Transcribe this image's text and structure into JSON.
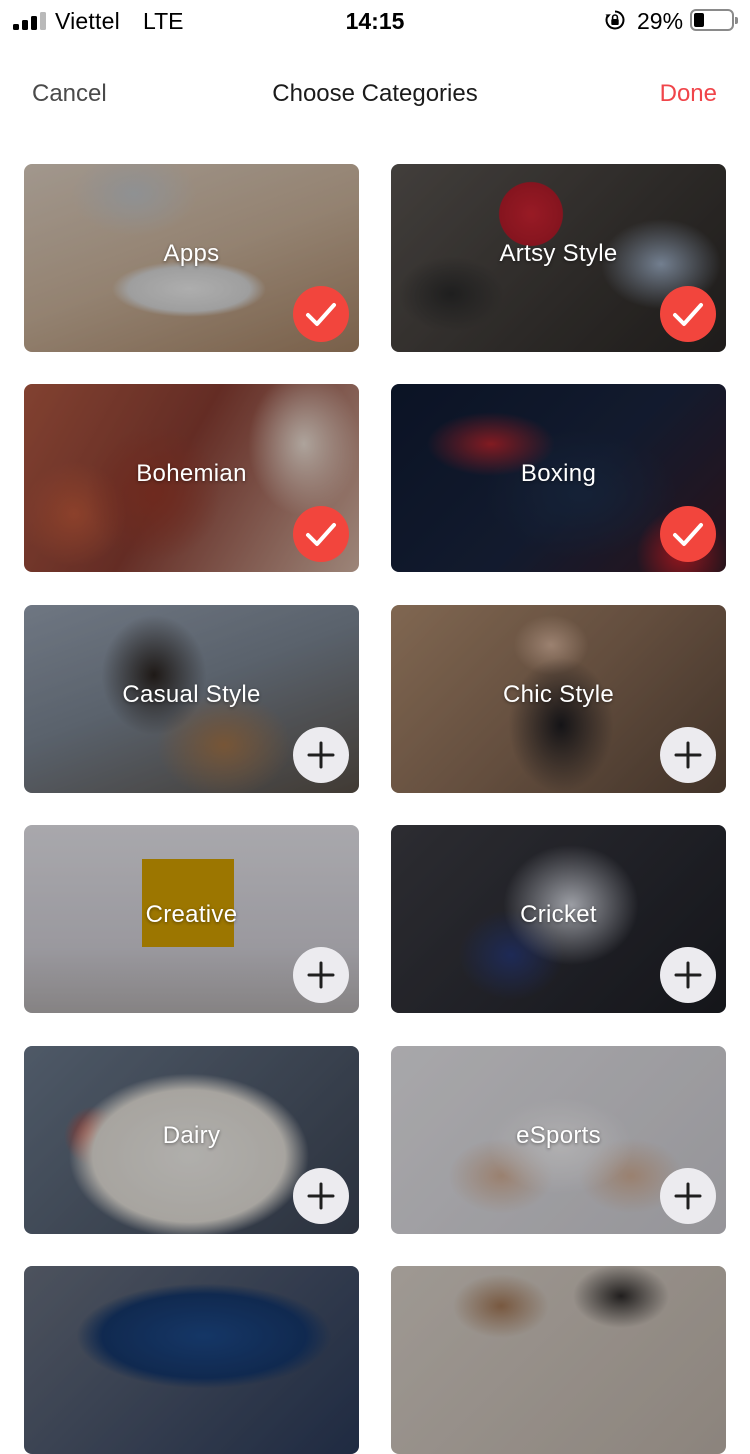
{
  "status_bar": {
    "carrier": "Viettel",
    "network": "LTE",
    "time": "14:15",
    "battery_percent": "29%",
    "battery_level": 0.29,
    "icons": [
      "signal-icon",
      "rotation-lock-icon",
      "battery-icon"
    ]
  },
  "nav": {
    "cancel_label": "Cancel",
    "title": "Choose Categories",
    "done_label": "Done",
    "done_color": "#f0454a"
  },
  "colors": {
    "selected_badge": "#f2453d",
    "add_badge": "#ecebef"
  },
  "categories": [
    {
      "label": "Apps",
      "selected": true
    },
    {
      "label": "Artsy Style",
      "selected": true
    },
    {
      "label": "Bohemian",
      "selected": true
    },
    {
      "label": "Boxing",
      "selected": true
    },
    {
      "label": "Casual Style",
      "selected": false
    },
    {
      "label": "Chic Style",
      "selected": false
    },
    {
      "label": "Creative",
      "selected": false
    },
    {
      "label": "Cricket",
      "selected": false
    },
    {
      "label": "Dairy",
      "selected": false
    },
    {
      "label": "eSports",
      "selected": false
    },
    {
      "label": "",
      "selected": false
    },
    {
      "label": "",
      "selected": false
    }
  ]
}
